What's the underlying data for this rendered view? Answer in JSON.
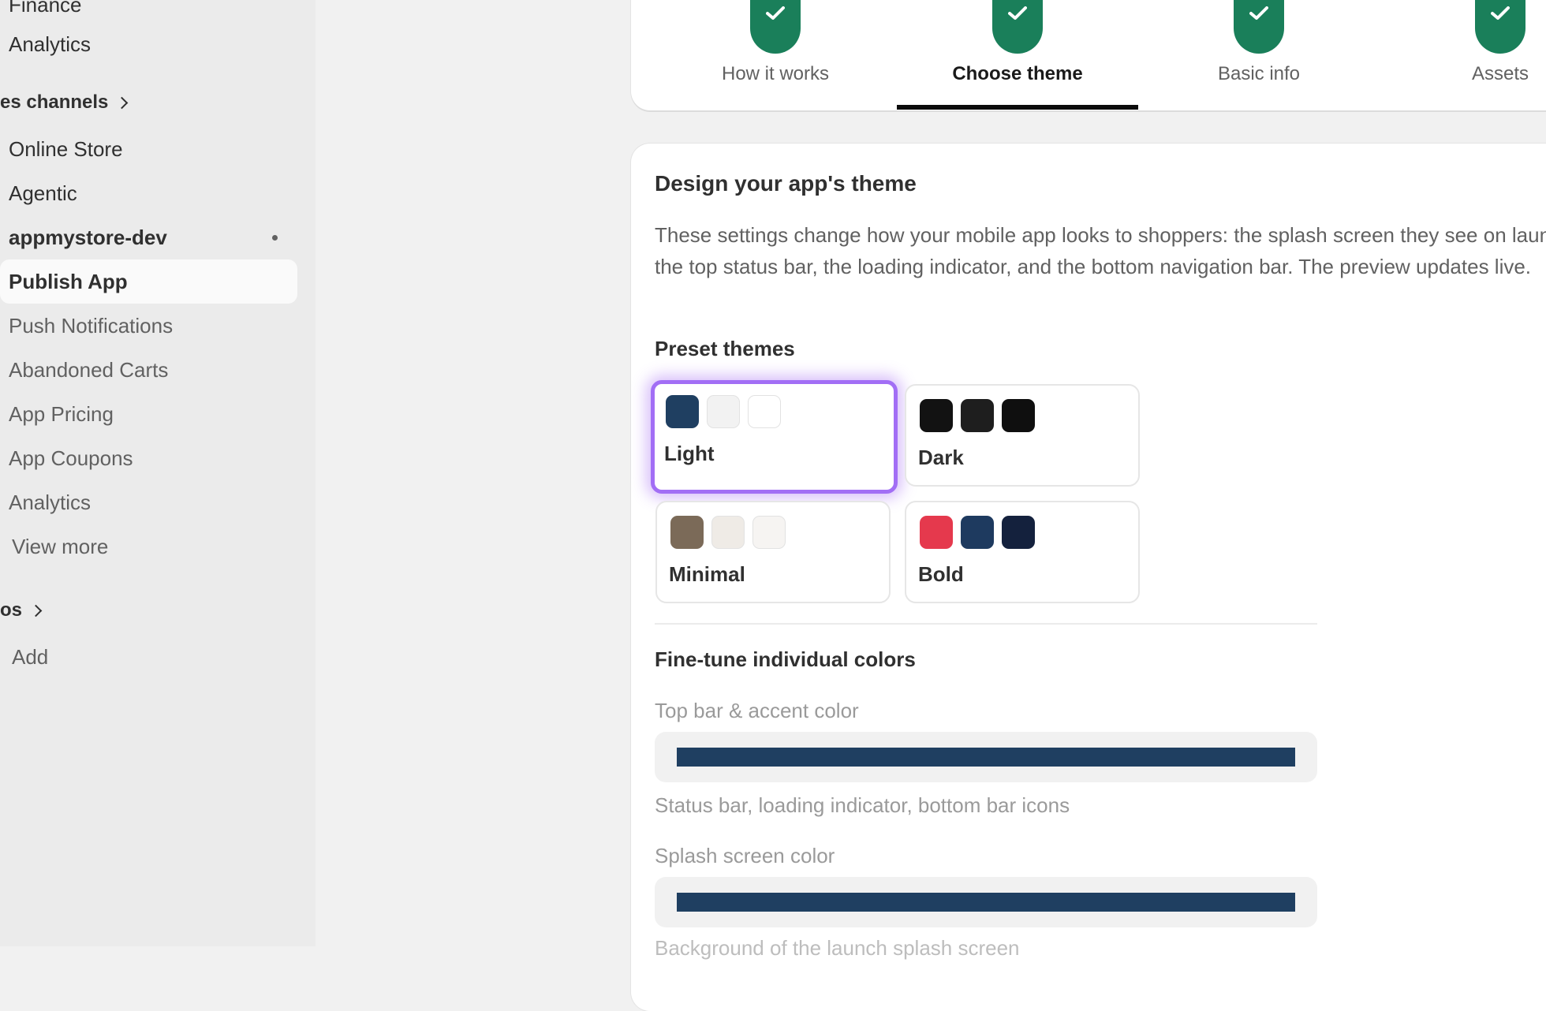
{
  "sidebar": {
    "finance": "Finance",
    "analytics_top": "Analytics",
    "sales_channels": "es channels",
    "online_store": "Online Store",
    "agentic": "Agentic",
    "app_name": "appmystore-dev",
    "sub_items": [
      "Publish App",
      "Push Notifications",
      "Abandoned Carts",
      "App Pricing",
      "App Coupons",
      "Analytics"
    ],
    "view_more": "View more",
    "apps": "os",
    "add": "Add"
  },
  "steps": [
    {
      "label": "How it works",
      "state": "done"
    },
    {
      "label": "Choose theme",
      "state": "active"
    },
    {
      "label": "Basic info",
      "state": "done"
    },
    {
      "label": "Assets",
      "state": "done"
    }
  ],
  "theme": {
    "title": "Design your app's theme",
    "description": "These settings change how your mobile app looks to shoppers: the splash screen they see on launch, the top status bar, the loading indicator, and the bottom navigation bar. The preview updates live.",
    "preset_heading": "Preset themes",
    "presets": [
      {
        "name": "Light",
        "selected": true,
        "colors": [
          "#1f3f61",
          "#f2f2f2",
          "#ffffff"
        ]
      },
      {
        "name": "Dark",
        "selected": false,
        "colors": [
          "#121212",
          "#1e1e1e",
          "#0f0f0f"
        ]
      },
      {
        "name": "Minimal",
        "selected": false,
        "colors": [
          "#7b6a58",
          "#efebe6",
          "#f6f4f2"
        ]
      },
      {
        "name": "Bold",
        "selected": false,
        "colors": [
          "#e5394d",
          "#1e3a5f",
          "#14213d"
        ]
      }
    ],
    "finetune_heading": "Fine-tune individual colors",
    "fields": [
      {
        "label": "Top bar & accent color",
        "color": "#1f3f61",
        "help": "Status bar, loading indicator, bottom bar icons"
      },
      {
        "label": "Splash screen color",
        "color": "#1f3f61",
        "help": "Background of the launch splash screen"
      }
    ]
  },
  "colors": {
    "check_green": "#1a7f5a",
    "selection_purple": "#a26ef5"
  }
}
